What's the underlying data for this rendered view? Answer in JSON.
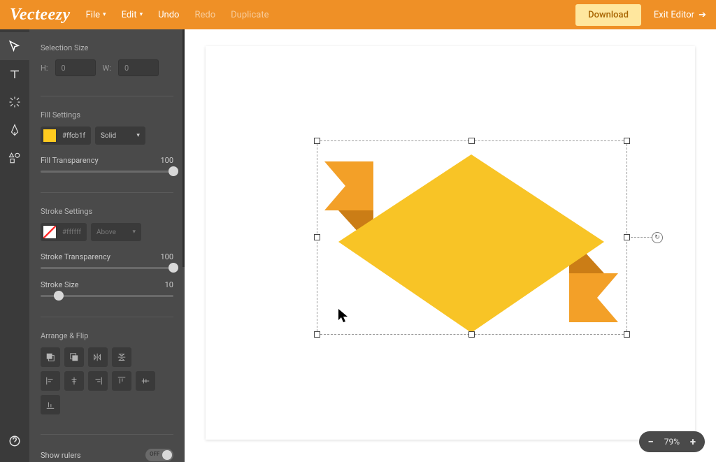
{
  "brand": "Vecteezy",
  "menu": {
    "file": "File",
    "edit": "Edit",
    "undo": "Undo",
    "redo": "Redo",
    "duplicate": "Duplicate"
  },
  "actions": {
    "download": "Download",
    "exit": "Exit Editor"
  },
  "panel": {
    "selection_size": "Selection Size",
    "h_label": "H:",
    "w_label": "W:",
    "h_value": "0",
    "w_value": "0",
    "fill_settings": "Fill Settings",
    "fill_hex": "#ffcb1f",
    "fill_type": "Solid",
    "fill_transparency_label": "Fill Transparency",
    "fill_transparency_value": "100",
    "stroke_settings": "Stroke Settings",
    "stroke_hex": "#ffffff",
    "stroke_pos": "Above",
    "stroke_transparency_label": "Stroke Transparency",
    "stroke_transparency_value": "100",
    "stroke_size_label": "Stroke Size",
    "stroke_size_value": "10",
    "arrange_flip": "Arrange & Flip",
    "show_rulers": "Show rulers",
    "rulers_off": "OFF"
  },
  "zoom": {
    "value": "79%"
  }
}
